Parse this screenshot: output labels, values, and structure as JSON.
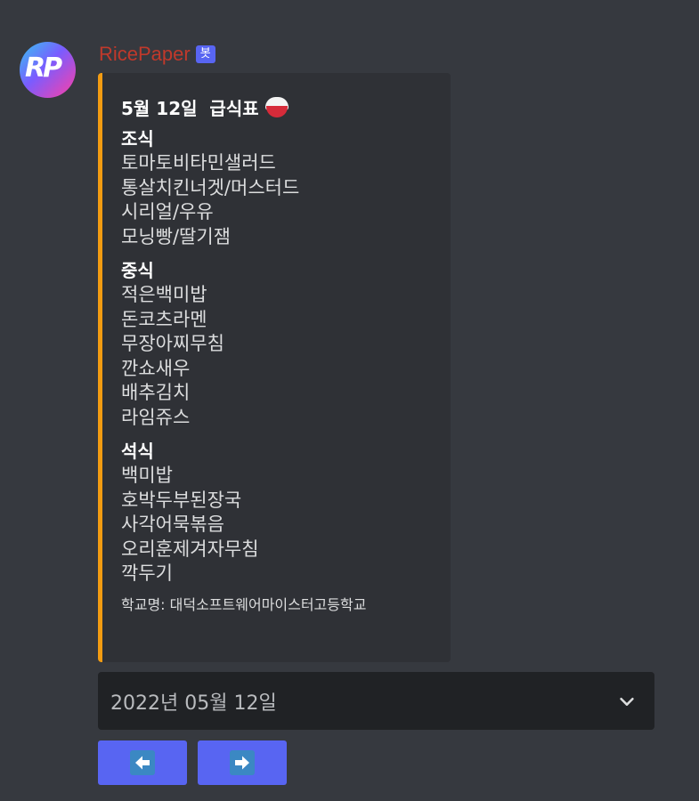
{
  "message": {
    "author": "RicePaper",
    "bot_badge": "봇",
    "avatar_text": "RP"
  },
  "embed": {
    "title": "5월 12일  급식표",
    "accent_color": "#f39c12",
    "title_icon": "rice-bowl-icon",
    "sections": [
      {
        "title": "조식",
        "items": [
          "토마토비타민샐러드",
          "통살치킨너겟/머스터드",
          "시리얼/우유",
          "모닝빵/딸기잼"
        ]
      },
      {
        "title": "중식",
        "items": [
          "적은백미밥",
          "돈코츠라멘",
          "무장아찌무침",
          "깐쇼새우",
          "배추김치",
          "라임쥬스"
        ]
      },
      {
        "title": "석식",
        "items": [
          "백미밥",
          "호박두부된장국",
          "사각어묵볶음",
          "오리훈제겨자무침",
          "깍두기"
        ]
      }
    ],
    "school": "학교명: 대덕소프트웨어마이스터고등학교"
  },
  "date_select": {
    "selected": "2022년 05월 12일",
    "icon": "chevron-down-icon"
  },
  "buttons": {
    "prev_icon": "left-arrow-icon",
    "next_icon": "right-arrow-icon",
    "color": "#5865f2"
  }
}
